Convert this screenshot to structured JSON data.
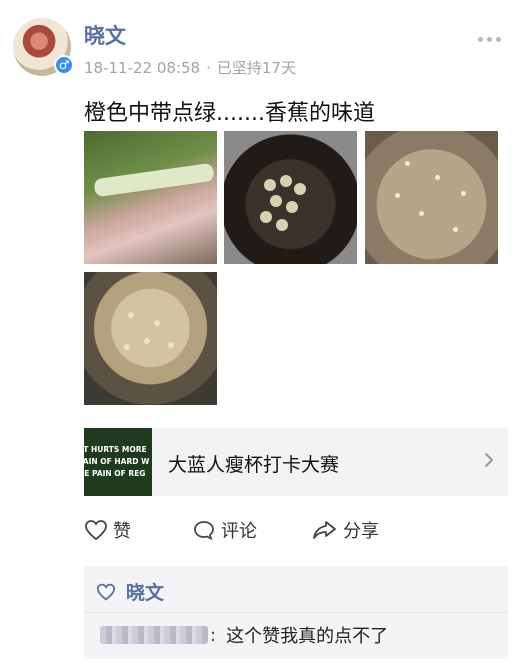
{
  "post": {
    "author": "晓文",
    "date": "18-11-22 08:58",
    "separator": "·",
    "streak": "已坚持17天",
    "text": "橙色中带点绿.......香蕉的味道"
  },
  "link_card": {
    "thumb_lines": [
      "AT HURTS MORE",
      "PAIN OF HARD W",
      "HE PAIN OF REG"
    ],
    "title": "大蓝人瘦杯打卡大赛"
  },
  "actions": {
    "like_label": "赞",
    "comment_label": "评论",
    "share_label": "分享"
  },
  "comments": {
    "liked_by": "晓文",
    "items": [
      {
        "text": "这个赞我真的点不了"
      }
    ]
  },
  "colors": {
    "name_blue": "#56719c",
    "meta_gray": "#a3a3a3",
    "panel_bg": "#f4f4f6"
  }
}
